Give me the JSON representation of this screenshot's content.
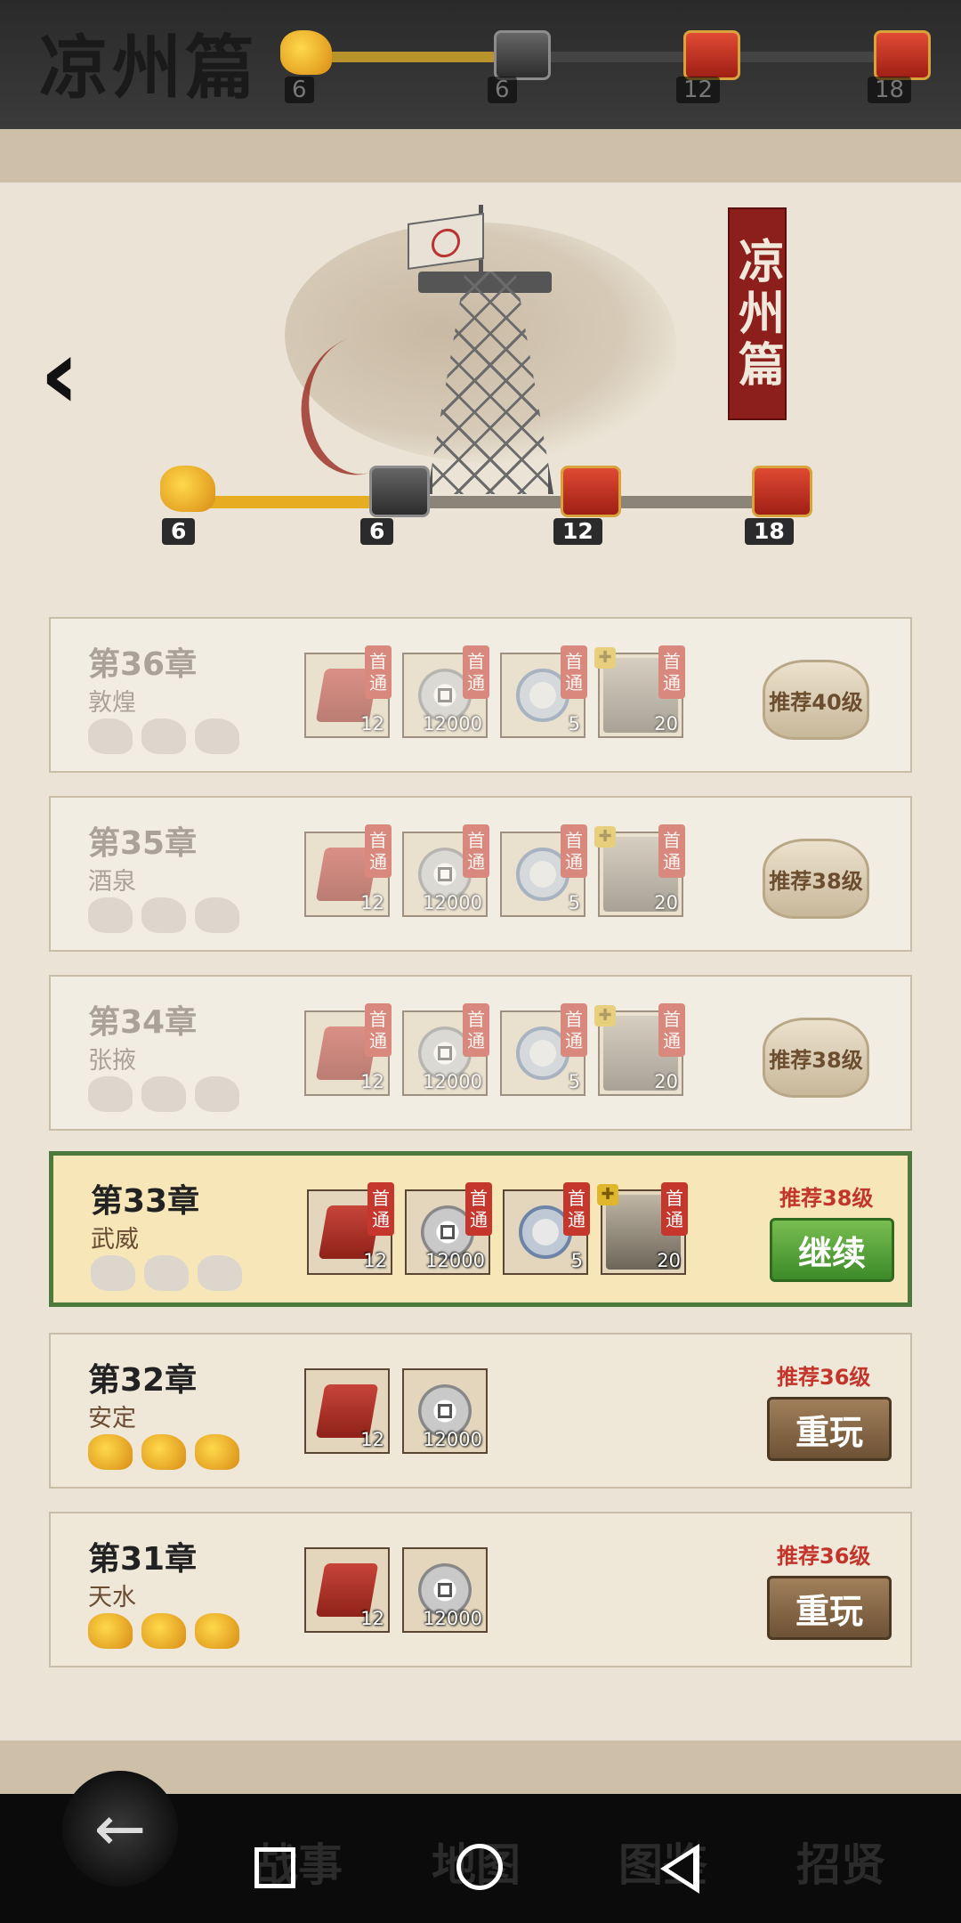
{
  "topbar": {
    "title": "凉州篇",
    "milestones": [
      "6",
      "6",
      "12",
      "18"
    ]
  },
  "header": {
    "seal": "凉州篇",
    "back_glyph": "‹",
    "milestones": [
      {
        "count": "6",
        "type": "lion-icon"
      },
      {
        "count": "6",
        "type": "chest-gray-icon"
      },
      {
        "count": "12",
        "type": "chest-red-icon"
      },
      {
        "count": "18",
        "type": "chest-red-icon"
      }
    ],
    "progress": 0.33
  },
  "chapters": [
    {
      "title": "第36章",
      "place": "敦煌",
      "state": "locked",
      "recommend": "推荐40级",
      "rewards": [
        {
          "count": "12",
          "tag": "首通"
        },
        {
          "count": "12000",
          "tag": "首通"
        },
        {
          "count": "5",
          "tag": "首通"
        },
        {
          "count": "20",
          "tag": "首通"
        }
      ]
    },
    {
      "title": "第35章",
      "place": "酒泉",
      "state": "locked",
      "recommend": "推荐38级",
      "rewards": [
        {
          "count": "12",
          "tag": "首通"
        },
        {
          "count": "12000",
          "tag": "首通"
        },
        {
          "count": "5",
          "tag": "首通"
        },
        {
          "count": "20",
          "tag": "首通"
        }
      ]
    },
    {
      "title": "第34章",
      "place": "张掖",
      "state": "locked",
      "recommend": "推荐38级",
      "rewards": [
        {
          "count": "12",
          "tag": "首通"
        },
        {
          "count": "12000",
          "tag": "首通"
        },
        {
          "count": "5",
          "tag": "首通"
        },
        {
          "count": "20",
          "tag": "首通"
        }
      ]
    },
    {
      "title": "第33章",
      "place": "武威",
      "state": "current",
      "recommend": "推荐38级",
      "button": "继续",
      "rewards": [
        {
          "count": "12",
          "tag": "首通"
        },
        {
          "count": "12000",
          "tag": "首通"
        },
        {
          "count": "5",
          "tag": "首通"
        },
        {
          "count": "20",
          "tag": "首通"
        }
      ]
    },
    {
      "title": "第32章",
      "place": "安定",
      "state": "done",
      "recommend": "推荐36级",
      "button": "重玩",
      "rewards": [
        {
          "count": "12"
        },
        {
          "count": "12000"
        }
      ]
    },
    {
      "title": "第31章",
      "place": "天水",
      "state": "done",
      "recommend": "推荐36级",
      "button": "重玩",
      "rewards": [
        {
          "count": "12"
        },
        {
          "count": "12000"
        }
      ]
    }
  ],
  "first_tag_chars": [
    "首",
    "通"
  ],
  "nav": {
    "tabs": [
      "战事",
      "地图",
      "图鉴",
      "招贤"
    ],
    "back_glyph": "←"
  }
}
